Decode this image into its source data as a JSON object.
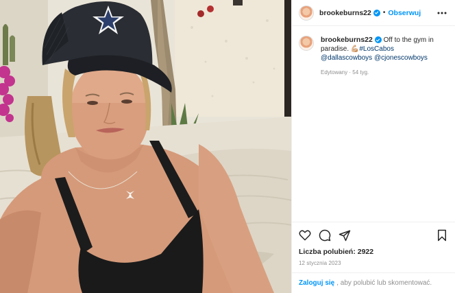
{
  "header": {
    "username": "brookeburns22",
    "separator": "•",
    "follow_label": "Obserwuj",
    "more_icon": "ellipsis-icon"
  },
  "caption": {
    "username": "brookeburns22",
    "text_1": "Off to the gym in paradise.",
    "emoji": "💪🏼",
    "hashtag": "#LosCabos",
    "mention_1": "@dallascowboys",
    "mention_2": "@cjonescowboys",
    "edited": "Edytowany · 54 tyg."
  },
  "actions": {
    "like_icon": "heart-icon",
    "comment_icon": "comment-icon",
    "share_icon": "share-icon",
    "save_icon": "bookmark-icon"
  },
  "likes": "Liczba polubień: 2922",
  "date": "12 stycznia 2023",
  "login": {
    "link": "Zaloguj się",
    "rest": ", aby polubić lub skomentować."
  },
  "colors": {
    "accent": "#0095f6",
    "text": "#262626",
    "muted": "#8e8e8e",
    "link": "#00376b"
  }
}
